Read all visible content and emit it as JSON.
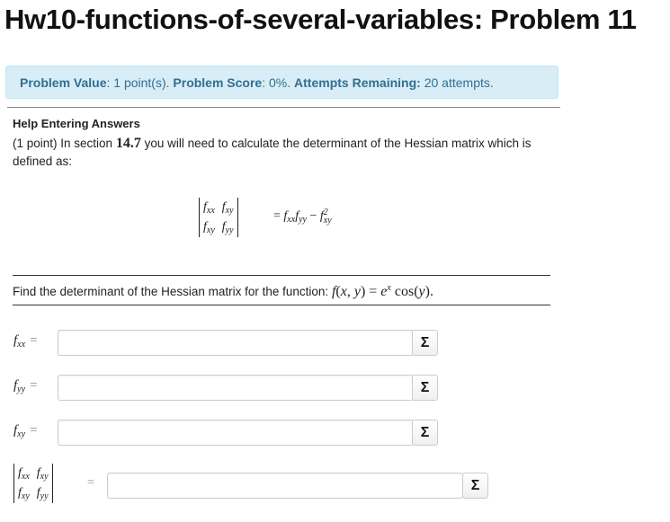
{
  "page": {
    "title": "Hw10-functions-of-several-variables: Problem 11"
  },
  "status": {
    "value_label": "Problem Value",
    "value_text": ": 1 point(s). ",
    "score_label": "Problem Score",
    "score_text": ": 0%. ",
    "attempts_label": "Attempts Remaining:",
    "attempts_text": " 20 attempts."
  },
  "problem": {
    "help_link": "Help Entering Answers",
    "intro_pre": "(1 point) In section ",
    "section": "14.7",
    "intro_post": " you will need to calculate the determinant of the Hessian matrix which is defined as:",
    "find_text": "Find the determinant of the Hessian matrix for the function: "
  },
  "answers": {
    "fxx": {
      "value": "",
      "placeholder": ""
    },
    "fyy": {
      "value": "",
      "placeholder": ""
    },
    "fxy": {
      "value": "",
      "placeholder": ""
    },
    "det": {
      "value": "",
      "placeholder": ""
    },
    "equation_editor_symbol": "Σ"
  },
  "colors": {
    "alert_bg": "#d9edf7",
    "alert_text": "#31708f",
    "alert_border": "#bce8f1"
  }
}
